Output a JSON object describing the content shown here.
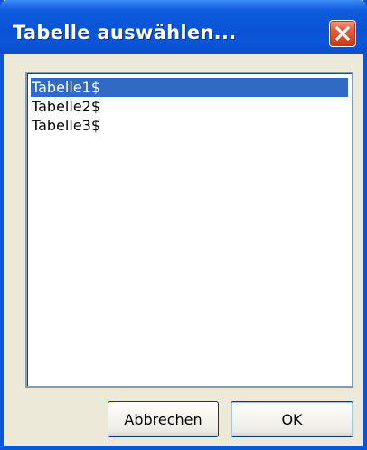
{
  "window": {
    "title": "Tabelle auswählen...",
    "close_icon": "close-icon"
  },
  "table_list": {
    "items": [
      {
        "label": "Tabelle1$",
        "selected": true
      },
      {
        "label": "Tabelle2$",
        "selected": false
      },
      {
        "label": "Tabelle3$",
        "selected": false
      }
    ]
  },
  "buttons": {
    "cancel_label": "Abbrechen",
    "ok_label": "OK"
  },
  "colors": {
    "titlebar": "#0b55d9",
    "selection": "#316ac5",
    "close_button": "#d54a28",
    "dialog_background": "#ece9d8"
  }
}
